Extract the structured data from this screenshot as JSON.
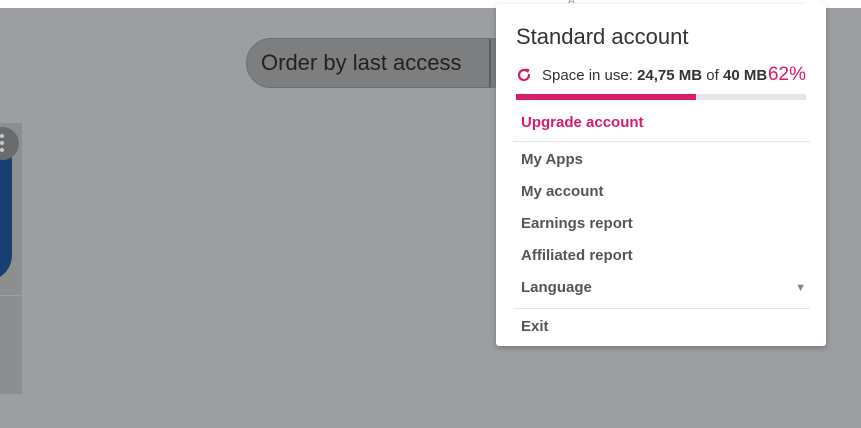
{
  "background": {
    "order_select": {
      "label": "Order by last access"
    }
  },
  "account_menu": {
    "title": "Standard account",
    "space": {
      "label": "Space in use:",
      "used": "24,75 MB",
      "of": "of",
      "total": "40 MB",
      "percent_label": "62%",
      "percent_value": 62
    },
    "upgrade_label": "Upgrade account",
    "items": [
      {
        "label": "My Apps"
      },
      {
        "label": "My account"
      },
      {
        "label": "Earnings report"
      },
      {
        "label": "Affiliated report"
      },
      {
        "label": "Language"
      }
    ],
    "exit_label": "Exit"
  },
  "colors": {
    "accent": "#d81b6a",
    "overlay": "#9c9ea2"
  },
  "icons": {
    "refresh": "refresh-icon",
    "language_caret": "triangle-down-icon"
  }
}
